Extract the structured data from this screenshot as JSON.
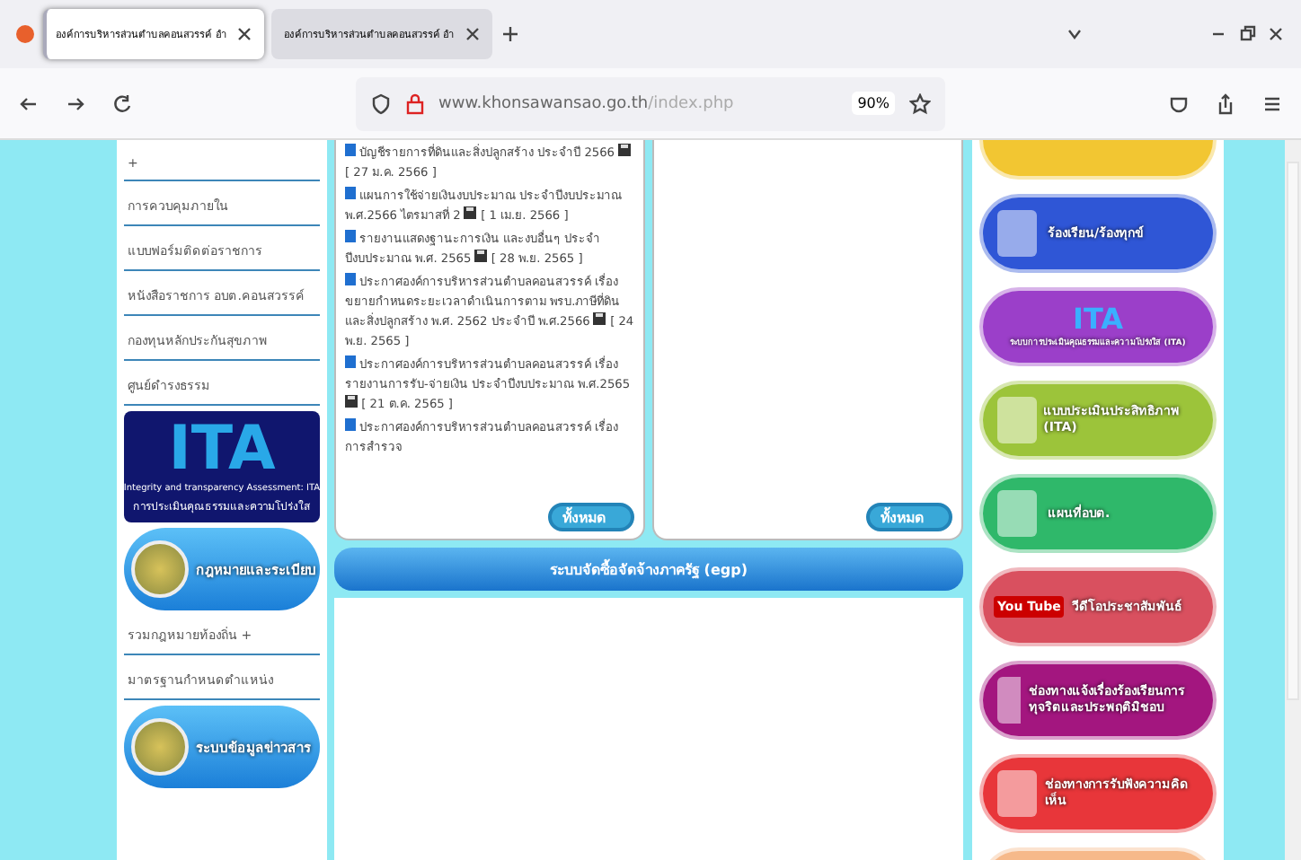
{
  "browser": {
    "tabs": [
      {
        "title": "องค์การบริหารส่วนตำบลคอนสวรรค์ อำ",
        "selected": true
      },
      {
        "title": "องค์การบริหารส่วนตำบลคอนสวรรค์ อำ",
        "selected": false
      }
    ],
    "url_host": "www.khonsawansao.go.th",
    "url_path": "/index.php",
    "zoom": "90%"
  },
  "left_sidebar": {
    "links_top": [
      "+",
      "การควบคุมภายใน",
      "แบบฟอร์มติดต่อราชการ",
      "หนังสือราชการ อบต.คอนสวรรค์",
      "กองทุนหลักประกันสุขภาพ",
      "ศูนย์ดำรงธรรม"
    ],
    "ita_banner": {
      "logo": "ITA",
      "title": "Integrity and transparency Assessment: ITA",
      "subtitle": "การประเมินคุณธรรมและความโปร่งใส"
    },
    "law_banner": "กฎหมายและระเบียบ",
    "links_bottom": [
      "รวมกฎหมายท้องถิ่น +",
      "มาตรฐานกำหนดตำแหน่ง"
    ],
    "info_banner": "ระบบข้อมูลข่าวสาร"
  },
  "news_panel": {
    "items": [
      {
        "text": "บัญชีรายการที่ดินและสิ่งปลูกสร้าง ประจำปี 2566",
        "date": "[ 27 ม.ค. 2566 ]"
      },
      {
        "text": "แผนการใช้จ่ายเงินงบประมาณ ประจำปีงบประมาณ พ.ศ.2566 ไตรมาสที่ 2",
        "date": "[ 1 เม.ย. 2566 ]"
      },
      {
        "text": "รายงานแสดงฐานะการเงิน และงบอื่นๆ ประจำปีงบประมาณ พ.ศ. 2565",
        "date": "[ 28 พ.ย. 2565 ]"
      },
      {
        "text": "ประกาศองค์การบริหารส่วนตำบลคอนสวรรค์ เรื่อง ขยายกำหนดระยะเวลาดำเนินการตาม พรบ.ภาษีที่ดินและสิ่งปลูกสร้าง พ.ศ. 2562 ประจำปี พ.ศ.2566",
        "date": "[ 24 พ.ย. 2565 ]"
      },
      {
        "text": "ประกาศองค์การบริหารส่วนตำบลคอนสวรรค์ เรื่อง รายงานการรับ-จ่ายเงิน ประจำปีงบประมาณ พ.ศ.2565",
        "date": "[ 21 ต.ค. 2565 ]"
      },
      {
        "text": "ประกาศองค์การบริหารส่วนตำบลคอนสวรรค์ เรื่อง การสำรวจ"
      }
    ],
    "more_button": "ทั้งหมด"
  },
  "second_panel": {
    "more_button": "ทั้งหมด"
  },
  "egp_bar": "ระบบจัดซื้อจัดจ้างภาครัฐ (egp)",
  "right_banners": [
    {
      "kind": "partial",
      "color": "#f2c632"
    },
    {
      "kind": "icon",
      "text": "ร้องเรียน/ร้องทุกข์",
      "color": "#2f56d6"
    },
    {
      "kind": "ita",
      "text": "ระบบการประเมินคุณธรรมและความโปร่งใส (ITA)",
      "logo": "ITA",
      "color": "#9b3fc9"
    },
    {
      "kind": "icon",
      "text": "แบบประเมินประสิทธิภาพ (ITA)",
      "color": "#9cc43a"
    },
    {
      "kind": "icon",
      "text": "แผนที่อบต.",
      "color": "#2fb86a"
    },
    {
      "kind": "youtube",
      "text": "วีดีโอประชาสัมพันธ์",
      "logo_a": "You",
      "logo_b": "Tube",
      "color": "#d9505f"
    },
    {
      "kind": "icon",
      "text": "ช่องทางแจ้งเรื่องร้องเรียนการทุจริตและประพฤติมิชอบ",
      "color": "#a3167f"
    },
    {
      "kind": "icon",
      "text": "ช่องทางการรับฟังความคิดเห็น",
      "color": "#e8363a"
    },
    {
      "kind": "partial",
      "color": "#f6b98a"
    }
  ]
}
